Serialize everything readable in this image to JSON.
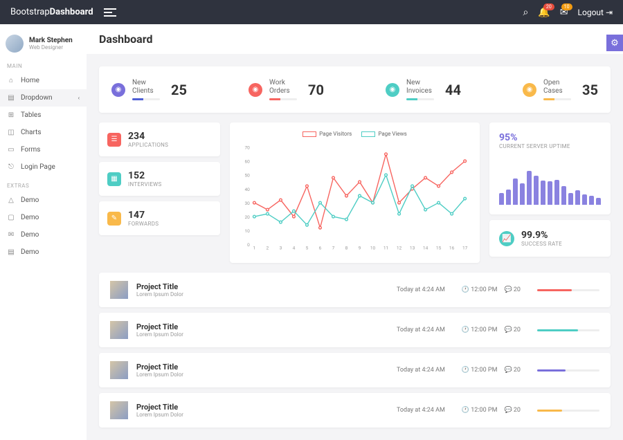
{
  "header": {
    "brand1": "Bootstrap",
    "brand2": "Dashboard",
    "logout": "Logout",
    "notif": "20",
    "msg": "10"
  },
  "user": {
    "name": "Mark Stephen",
    "role": "Web Designer"
  },
  "sidebar": {
    "section1": "MAIN",
    "section2": "EXTRAS",
    "items": [
      {
        "icon": "⌂",
        "label": "Home"
      },
      {
        "icon": "▤",
        "label": "Dropdown",
        "chev": true
      },
      {
        "icon": "⊞",
        "label": "Tables"
      },
      {
        "icon": "◫",
        "label": "Charts"
      },
      {
        "icon": "▭",
        "label": "Forms"
      },
      {
        "icon": "⎋",
        "label": "Login Page"
      }
    ],
    "extras": [
      {
        "icon": "△",
        "label": "Demo"
      },
      {
        "icon": "▢",
        "label": "Demo"
      },
      {
        "icon": "✉",
        "label": "Demo"
      },
      {
        "icon": "▤",
        "label": "Demo"
      }
    ]
  },
  "page": {
    "title": "Dashboard"
  },
  "stats": [
    {
      "label1": "New",
      "label2": "Clients",
      "val": "25",
      "color": "#796fdb",
      "bar": "#4e5fd4"
    },
    {
      "label1": "Work",
      "label2": "Orders",
      "val": "70",
      "color": "#f76560",
      "bar": "#f76560"
    },
    {
      "label1": "New",
      "label2": "Invoices",
      "val": "44",
      "color": "#4ecdc4",
      "bar": "#4ecdc4"
    },
    {
      "label1": "Open",
      "label2": "Cases",
      "val": "35",
      "color": "#f9b94a",
      "bar": "#f9b94a"
    }
  ],
  "minis": [
    {
      "color": "#f76560",
      "val": "234",
      "label": "APPLICATIONS",
      "icon": "☰"
    },
    {
      "color": "#4ecdc4",
      "val": "152",
      "label": "INTERVIEWS",
      "icon": "▦"
    },
    {
      "color": "#f9b94a",
      "val": "147",
      "label": "FORWARDS",
      "icon": "✎"
    }
  ],
  "chart_data": {
    "type": "line",
    "legend": [
      "Page Visitors",
      "Page Views"
    ],
    "x": [
      1,
      2,
      3,
      4,
      5,
      6,
      7,
      8,
      9,
      10,
      11,
      12,
      13,
      14,
      15,
      16,
      17
    ],
    "ylim": [
      0,
      70
    ],
    "series": [
      {
        "name": "Page Visitors",
        "color": "#f76560",
        "values": [
          30,
          25,
          32,
          20,
          42,
          12,
          48,
          35,
          45,
          30,
          65,
          30,
          40,
          48,
          42,
          52,
          60
        ]
      },
      {
        "name": "Page Views",
        "color": "#4ecdc4",
        "values": [
          20,
          22,
          16,
          24,
          14,
          30,
          20,
          18,
          35,
          30,
          50,
          22,
          42,
          25,
          30,
          22,
          33
        ]
      }
    ]
  },
  "uptime": {
    "val": "95%",
    "label": "CURRENT SERVER UPTIME",
    "bars": [
      25,
      32,
      55,
      45,
      70,
      60,
      50,
      48,
      52,
      38,
      25,
      30,
      22,
      18,
      15
    ]
  },
  "success": {
    "val": "99.9%",
    "label": "SUCCESS RATE"
  },
  "projects": [
    {
      "title": "Project Title",
      "sub": "Lorem Ipsum Dolor",
      "time": "Today at 4:24 AM",
      "clock": "12:00 PM",
      "cmt": "20",
      "color": "#f76560",
      "pct": 55
    },
    {
      "title": "Project Title",
      "sub": "Lorem Ipsum Dolor",
      "time": "Today at 4:24 AM",
      "clock": "12:00 PM",
      "cmt": "20",
      "color": "#4ecdc4",
      "pct": 65
    },
    {
      "title": "Project Title",
      "sub": "Lorem Ipsum Dolor",
      "time": "Today at 4:24 AM",
      "clock": "12:00 PM",
      "cmt": "20",
      "color": "#796fdb",
      "pct": 45
    },
    {
      "title": "Project Title",
      "sub": "Lorem Ipsum Dolor",
      "time": "Today at 4:24 AM",
      "clock": "12:00 PM",
      "cmt": "20",
      "color": "#f9b94a",
      "pct": 40
    }
  ]
}
